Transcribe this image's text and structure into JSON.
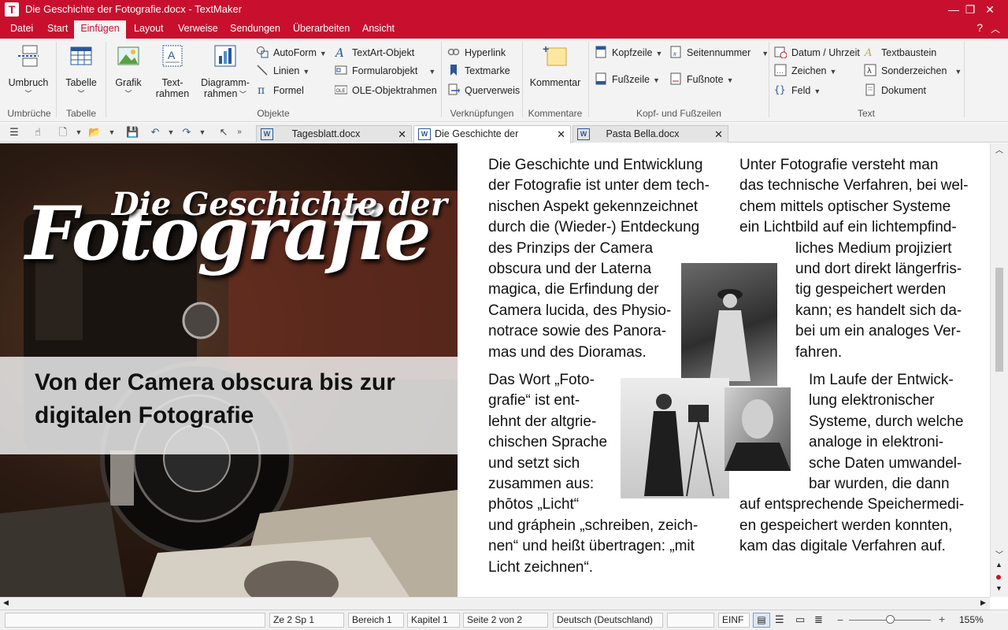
{
  "window": {
    "title": "Die Geschichte der Fotografie.docx - TextMaker",
    "app_icon_letter": "T",
    "controls": {
      "minimize": "—",
      "restore": "❐",
      "close": "✕"
    }
  },
  "menu": {
    "tabs": [
      "Datei",
      "Start",
      "Einfügen",
      "Layout",
      "Verweise",
      "Sendungen",
      "Überarbeiten",
      "Ansicht"
    ],
    "active": "Einfügen",
    "help": "?",
    "collapse": "︿"
  },
  "ribbon": {
    "groups": {
      "umbrueche": {
        "label": "Umbrüche",
        "umbruch": "Umbruch"
      },
      "tabelle": {
        "label": "Tabelle",
        "tabelle": "Tabelle"
      },
      "objekte": {
        "label": "Objekte",
        "grafik": "Grafik",
        "textrahmen_1": "Text-",
        "textrahmen_2": "rahmen",
        "diagramm_1": "Diagramm-",
        "diagramm_2": "rahmen",
        "autoform": "AutoForm",
        "linien": "Linien",
        "formel": "Formel",
        "textart": "TextArt-Objekt",
        "formularobjekt": "Formularobjekt",
        "ole": "OLE-Objektrahmen"
      },
      "verknuepfungen": {
        "label": "Verknüpfungen",
        "hyperlink": "Hyperlink",
        "textmarke": "Textmarke",
        "querverweis": "Querverweis"
      },
      "kommentare": {
        "label": "Kommentare",
        "kommentar": "Kommentar"
      },
      "kopffuss": {
        "label": "Kopf- und Fußzeilen",
        "kopfzeile": "Kopfzeile",
        "fusszeile": "Fußzeile",
        "seitennummer": "Seitennummer",
        "fussnote": "Fußnote"
      },
      "text": {
        "label": "Text",
        "datum": "Datum / Uhrzeit",
        "zeichen": "Zeichen",
        "feld": "Feld",
        "textbaustein": "Textbaustein",
        "sonderzeichen": "Sonderzeichen",
        "dokument": "Dokument"
      }
    }
  },
  "doc_tabs": [
    {
      "title": "Tagesblatt.docx"
    },
    {
      "title": "Die Geschichte der Fotogr..."
    },
    {
      "title": "Pasta Bella.docx"
    }
  ],
  "document": {
    "hero_title_line1": "Die Geschichte der",
    "hero_title_line2": "Fotografie",
    "hero_subtitle": "Von der Camera obscura bis zur digitalen Fotografie",
    "col1_p1": [
      "Die Geschichte und Entwicklung",
      "der Fotografie ist unter dem tech-",
      "nischen Aspekt gekennzeichnet",
      "durch die (Wieder-) Entdeckung",
      "des Prinzips der Camera",
      "obscura und der Laterna",
      "magica, die Erfindung der",
      "Camera lucida, des Physio-",
      "notrace sowie des Panora-",
      "mas und des Dioramas."
    ],
    "col1_p2": [
      "Das Wort „Foto-",
      "grafie“ ist ent-",
      "lehnt der altgrie-",
      "chischen Sprache",
      "und setzt sich",
      "zusammen aus:",
      "phōtos  „Licht“",
      "und gráphein „schreiben, zeich-",
      "nen“ und heißt übertragen:  „mit",
      "Licht zeichnen“."
    ],
    "col2_p1a": [
      "Unter Fotografie versteht man",
      "das technische Verfahren, bei wel-",
      "chem mittels optischer Systeme",
      "ein Lichtbild auf ein lichtempfind-"
    ],
    "col2_p1b": [
      "liches Medium projiziert",
      "und dort direkt längerfris-",
      "tig gespeichert werden",
      "kann; es handelt sich da-",
      "bei um ein analoges Ver-",
      "fahren."
    ],
    "col2_p2a": [
      "Im Laufe der Entwick-",
      "lung elektronischer",
      "Systeme, durch welche",
      "analoge in elektroni-",
      "sche Daten umwandel-",
      "bar wurden, die dann"
    ],
    "col2_p2b": [
      "auf entsprechende Speichermedi-",
      "en gespeichert werden konnten,",
      "kam das digitale Verfahren auf."
    ]
  },
  "status": {
    "position": "Ze 2 Sp 1",
    "bereich": "Bereich 1",
    "kapitel": "Kapitel 1",
    "seite": "Seite 2 von 2",
    "sprache": "Deutsch (Deutschland)",
    "mode": "EINF",
    "zoom_minus": "−",
    "zoom_plus": "+",
    "zoom": "155%"
  },
  "colors": {
    "brand": "#c8102e",
    "ribbon_bg": "#f3f3f3"
  }
}
